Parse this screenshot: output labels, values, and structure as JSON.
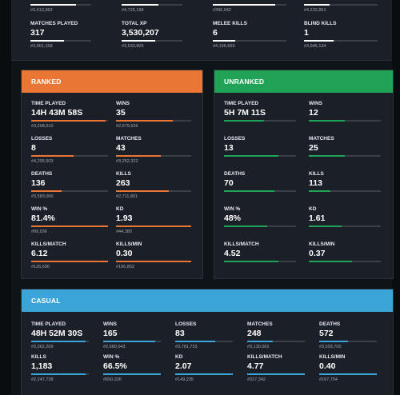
{
  "top": {
    "row0": [
      {
        "rank": "#3,413,383",
        "fill": 0.75
      },
      {
        "rank": "#4,725,198",
        "fill": 0.6
      },
      {
        "rank": "#396,942",
        "fill": 0.85
      },
      {
        "rank": "#4,232,851",
        "fill": 0.35
      }
    ],
    "row1": [
      {
        "label": "MATCHES PLAYED",
        "value": "317",
        "rank": "#3,961,158",
        "fill": 0.55
      },
      {
        "label": "TOTAL XP",
        "value": "3,530,207",
        "rank": "#3,533,805",
        "fill": 0.55
      },
      {
        "label": "MELEE KILLS",
        "value": "6",
        "rank": "#4,156,669",
        "fill": 0.3
      },
      {
        "label": "BLIND KILLS",
        "value": "1",
        "rank": "#3,945,134",
        "fill": 0.4
      }
    ]
  },
  "ranked": {
    "title": "RANKED",
    "color": "#e97635",
    "stats": [
      {
        "label": "TIME PLAYED",
        "value": "14H 43M 58S",
        "rank": "#3,208,510",
        "fill": 0.97
      },
      {
        "label": "WINS",
        "value": "35",
        "rank": "#2,679,526",
        "fill": 0.75
      },
      {
        "label": "LOSSES",
        "value": "8",
        "rank": "#4,205,503",
        "fill": 0.55
      },
      {
        "label": "MATCHES",
        "value": "43",
        "rank": "#3,252,322",
        "fill": 0.6
      },
      {
        "label": "DEATHS",
        "value": "136",
        "rank": "#3,583,000",
        "fill": 0.4
      },
      {
        "label": "KILLS",
        "value": "263",
        "rank": "#2,711,801",
        "fill": 0.7
      },
      {
        "label": "WIN %",
        "value": "81.4%",
        "rank": "#99,036",
        "fill": 1.0
      },
      {
        "label": "KD",
        "value": "1.93",
        "rank": "#44,380",
        "fill": 1.0
      },
      {
        "label": "KILLS/MATCH",
        "value": "6.12",
        "rank": "#126,690",
        "fill": 1.0
      },
      {
        "label": "KILLS/MIN",
        "value": "0.30",
        "rank": "#156,852",
        "fill": 1.0
      }
    ]
  },
  "unranked": {
    "title": "UNRANKED",
    "color": "#20a257",
    "stats": [
      {
        "label": "TIME PLAYED",
        "value": "5H 7M 11S",
        "fill": 0.55
      },
      {
        "label": "WINS",
        "value": "12",
        "fill": 0.5
      },
      {
        "label": "LOSSES",
        "value": "13",
        "fill": 0.75
      },
      {
        "label": "MATCHES",
        "value": "25",
        "fill": 0.5
      },
      {
        "label": "DEATHS",
        "value": "70",
        "fill": 0.7
      },
      {
        "label": "KILLS",
        "value": "113",
        "fill": 0.3
      },
      {
        "label": "WIN %",
        "value": "48%",
        "fill": 0.6
      },
      {
        "label": "KD",
        "value": "1.61",
        "fill": 0.45
      },
      {
        "label": "KILLS/MATCH",
        "value": "4.52",
        "fill": 0.75
      },
      {
        "label": "KILLS/MIN",
        "value": "0.37",
        "fill": 0.6
      }
    ]
  },
  "casual": {
    "title": "CASUAL",
    "color": "#3ba4d8",
    "stats": [
      {
        "label": "TIME PLAYED",
        "value": "48H 52M 30S",
        "rank": "#3,362,209",
        "fill": 0.95
      },
      {
        "label": "WINS",
        "value": "165",
        "rank": "#2,680,043",
        "fill": 0.9
      },
      {
        "label": "LOSSES",
        "value": "83",
        "rank": "#3,781,733",
        "fill": 0.7
      },
      {
        "label": "MATCHES",
        "value": "248",
        "rank": "#3,130,002",
        "fill": 0.45
      },
      {
        "label": "DEATHS",
        "value": "572",
        "rank": "#3,593,700",
        "fill": 0.5
      },
      {
        "label": "KILLS",
        "value": "1,183",
        "rank": "#2,247,738",
        "fill": 0.95
      },
      {
        "label": "WIN %",
        "value": "66.5%",
        "rank": "#650,326",
        "fill": 1.0
      },
      {
        "label": "KD",
        "value": "2.07",
        "rank": "#149,235",
        "fill": 1.0
      },
      {
        "label": "KILLS/MATCH",
        "value": "4.77",
        "rank": "#327,342",
        "fill": 1.0
      },
      {
        "label": "KILLS/MIN",
        "value": "0.40",
        "rank": "#167,754",
        "fill": 1.0
      }
    ]
  }
}
